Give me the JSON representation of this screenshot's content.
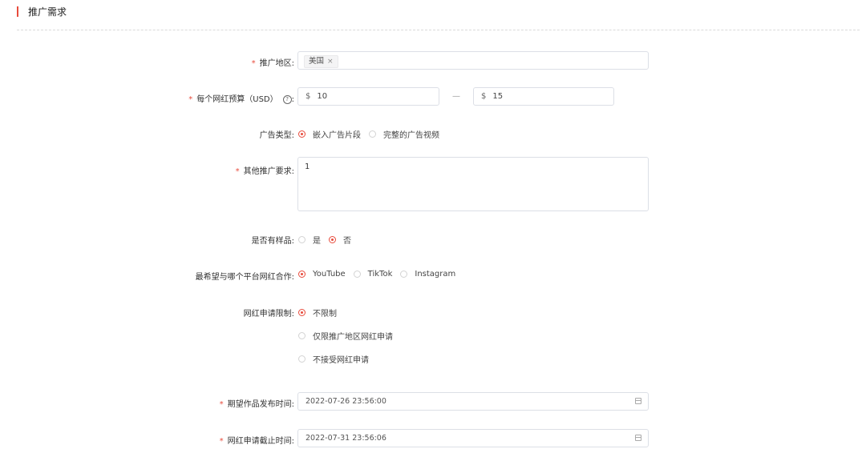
{
  "section": {
    "title": "推广需求",
    "accent_color": "#e84c3d"
  },
  "region": {
    "label": "推广地区:",
    "tag": "美国",
    "tag_remove": "×"
  },
  "budget": {
    "label": "每个网红预算（USD）",
    "help_icon": "?",
    "colon": ":",
    "currency": "$",
    "min": "10",
    "separator": "—",
    "max": "15"
  },
  "ad_type": {
    "label": "广告类型:",
    "options": [
      "嵌入广告片段",
      "完整的广告视频"
    ],
    "selected": 0
  },
  "other": {
    "label": "其他推广要求:",
    "value": "1"
  },
  "sample": {
    "label": "是否有样品:",
    "options": [
      "是",
      "否"
    ],
    "selected": 1
  },
  "platform": {
    "label": "最希望与哪个平台网红合作:",
    "options": [
      "YouTube",
      "TikTok",
      "Instagram"
    ],
    "selected": 0
  },
  "restriction": {
    "label": "网红申请限制:",
    "options": [
      "不限制",
      "仅限推广地区网红申请",
      "不接受网红申请"
    ],
    "selected": 0
  },
  "publish_time": {
    "label": "期望作品发布时间:",
    "value": "2022-07-26 23:56:00"
  },
  "deadline": {
    "label": "网红申请截止时间:",
    "value": "2022-07-31 23:56:06"
  },
  "required_mark": "*"
}
